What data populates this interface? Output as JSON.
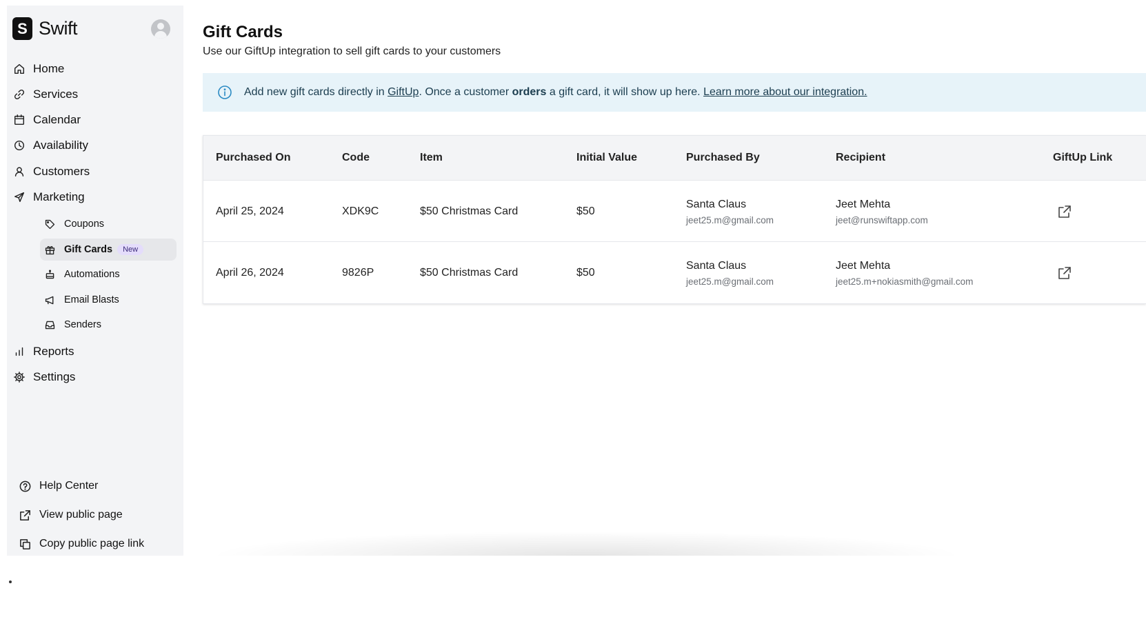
{
  "app": {
    "name": "Swift"
  },
  "sidebar": {
    "nav": [
      {
        "label": "Home",
        "icon": "home-icon"
      },
      {
        "label": "Services",
        "icon": "link-icon"
      },
      {
        "label": "Calendar",
        "icon": "calendar-icon"
      },
      {
        "label": "Availability",
        "icon": "clock-icon"
      },
      {
        "label": "Customers",
        "icon": "user-icon"
      },
      {
        "label": "Marketing",
        "icon": "paper-plane-icon"
      }
    ],
    "marketing_sub": [
      {
        "label": "Coupons",
        "icon": "tag-icon"
      },
      {
        "label": "Gift Cards",
        "icon": "gift-icon",
        "badge": "New",
        "active": true
      },
      {
        "label": "Automations",
        "icon": "robot-icon"
      },
      {
        "label": "Email Blasts",
        "icon": "megaphone-icon"
      },
      {
        "label": "Senders",
        "icon": "inbox-icon"
      }
    ],
    "nav_after": [
      {
        "label": "Reports",
        "icon": "bar-chart-icon"
      },
      {
        "label": "Settings",
        "icon": "gear-icon"
      }
    ],
    "footer": [
      {
        "label": "Help Center",
        "icon": "question-circle-icon"
      },
      {
        "label": "View public page",
        "icon": "external-link-icon"
      },
      {
        "label": "Copy public page link",
        "icon": "copy-icon"
      }
    ]
  },
  "page": {
    "title": "Gift Cards",
    "subtitle": "Use our GiftUp integration to sell gift cards to your customers"
  },
  "banner": {
    "text1": "Add new gift cards directly in ",
    "link1": "GiftUp",
    "text2": ". Once a customer ",
    "bold": "orders",
    "text3": " a gift card, it will show up here. ",
    "link2": "Learn more about our integration.",
    "accent": "#2b8ac3"
  },
  "table": {
    "columns": [
      "Purchased On",
      "Code",
      "Item",
      "Initial Value",
      "Purchased By",
      "Recipient",
      "GiftUp Link"
    ],
    "rows": [
      {
        "purchased_on": "April 25, 2024",
        "code": "XDK9C",
        "item": "$50 Christmas Card",
        "initial_value": "$50",
        "purchased_by_name": "Santa Claus",
        "purchased_by_email": "jeet25.m@gmail.com",
        "recipient_name": "Jeet Mehta",
        "recipient_email": "jeet@runswiftapp.com"
      },
      {
        "purchased_on": "April 26, 2024",
        "code": "9826P",
        "item": "$50 Christmas Card",
        "initial_value": "$50",
        "purchased_by_name": "Santa Claus",
        "purchased_by_email": "jeet25.m@gmail.com",
        "recipient_name": "Jeet Mehta",
        "recipient_email": "jeet25.m+nokiasmith@gmail.com"
      }
    ]
  }
}
